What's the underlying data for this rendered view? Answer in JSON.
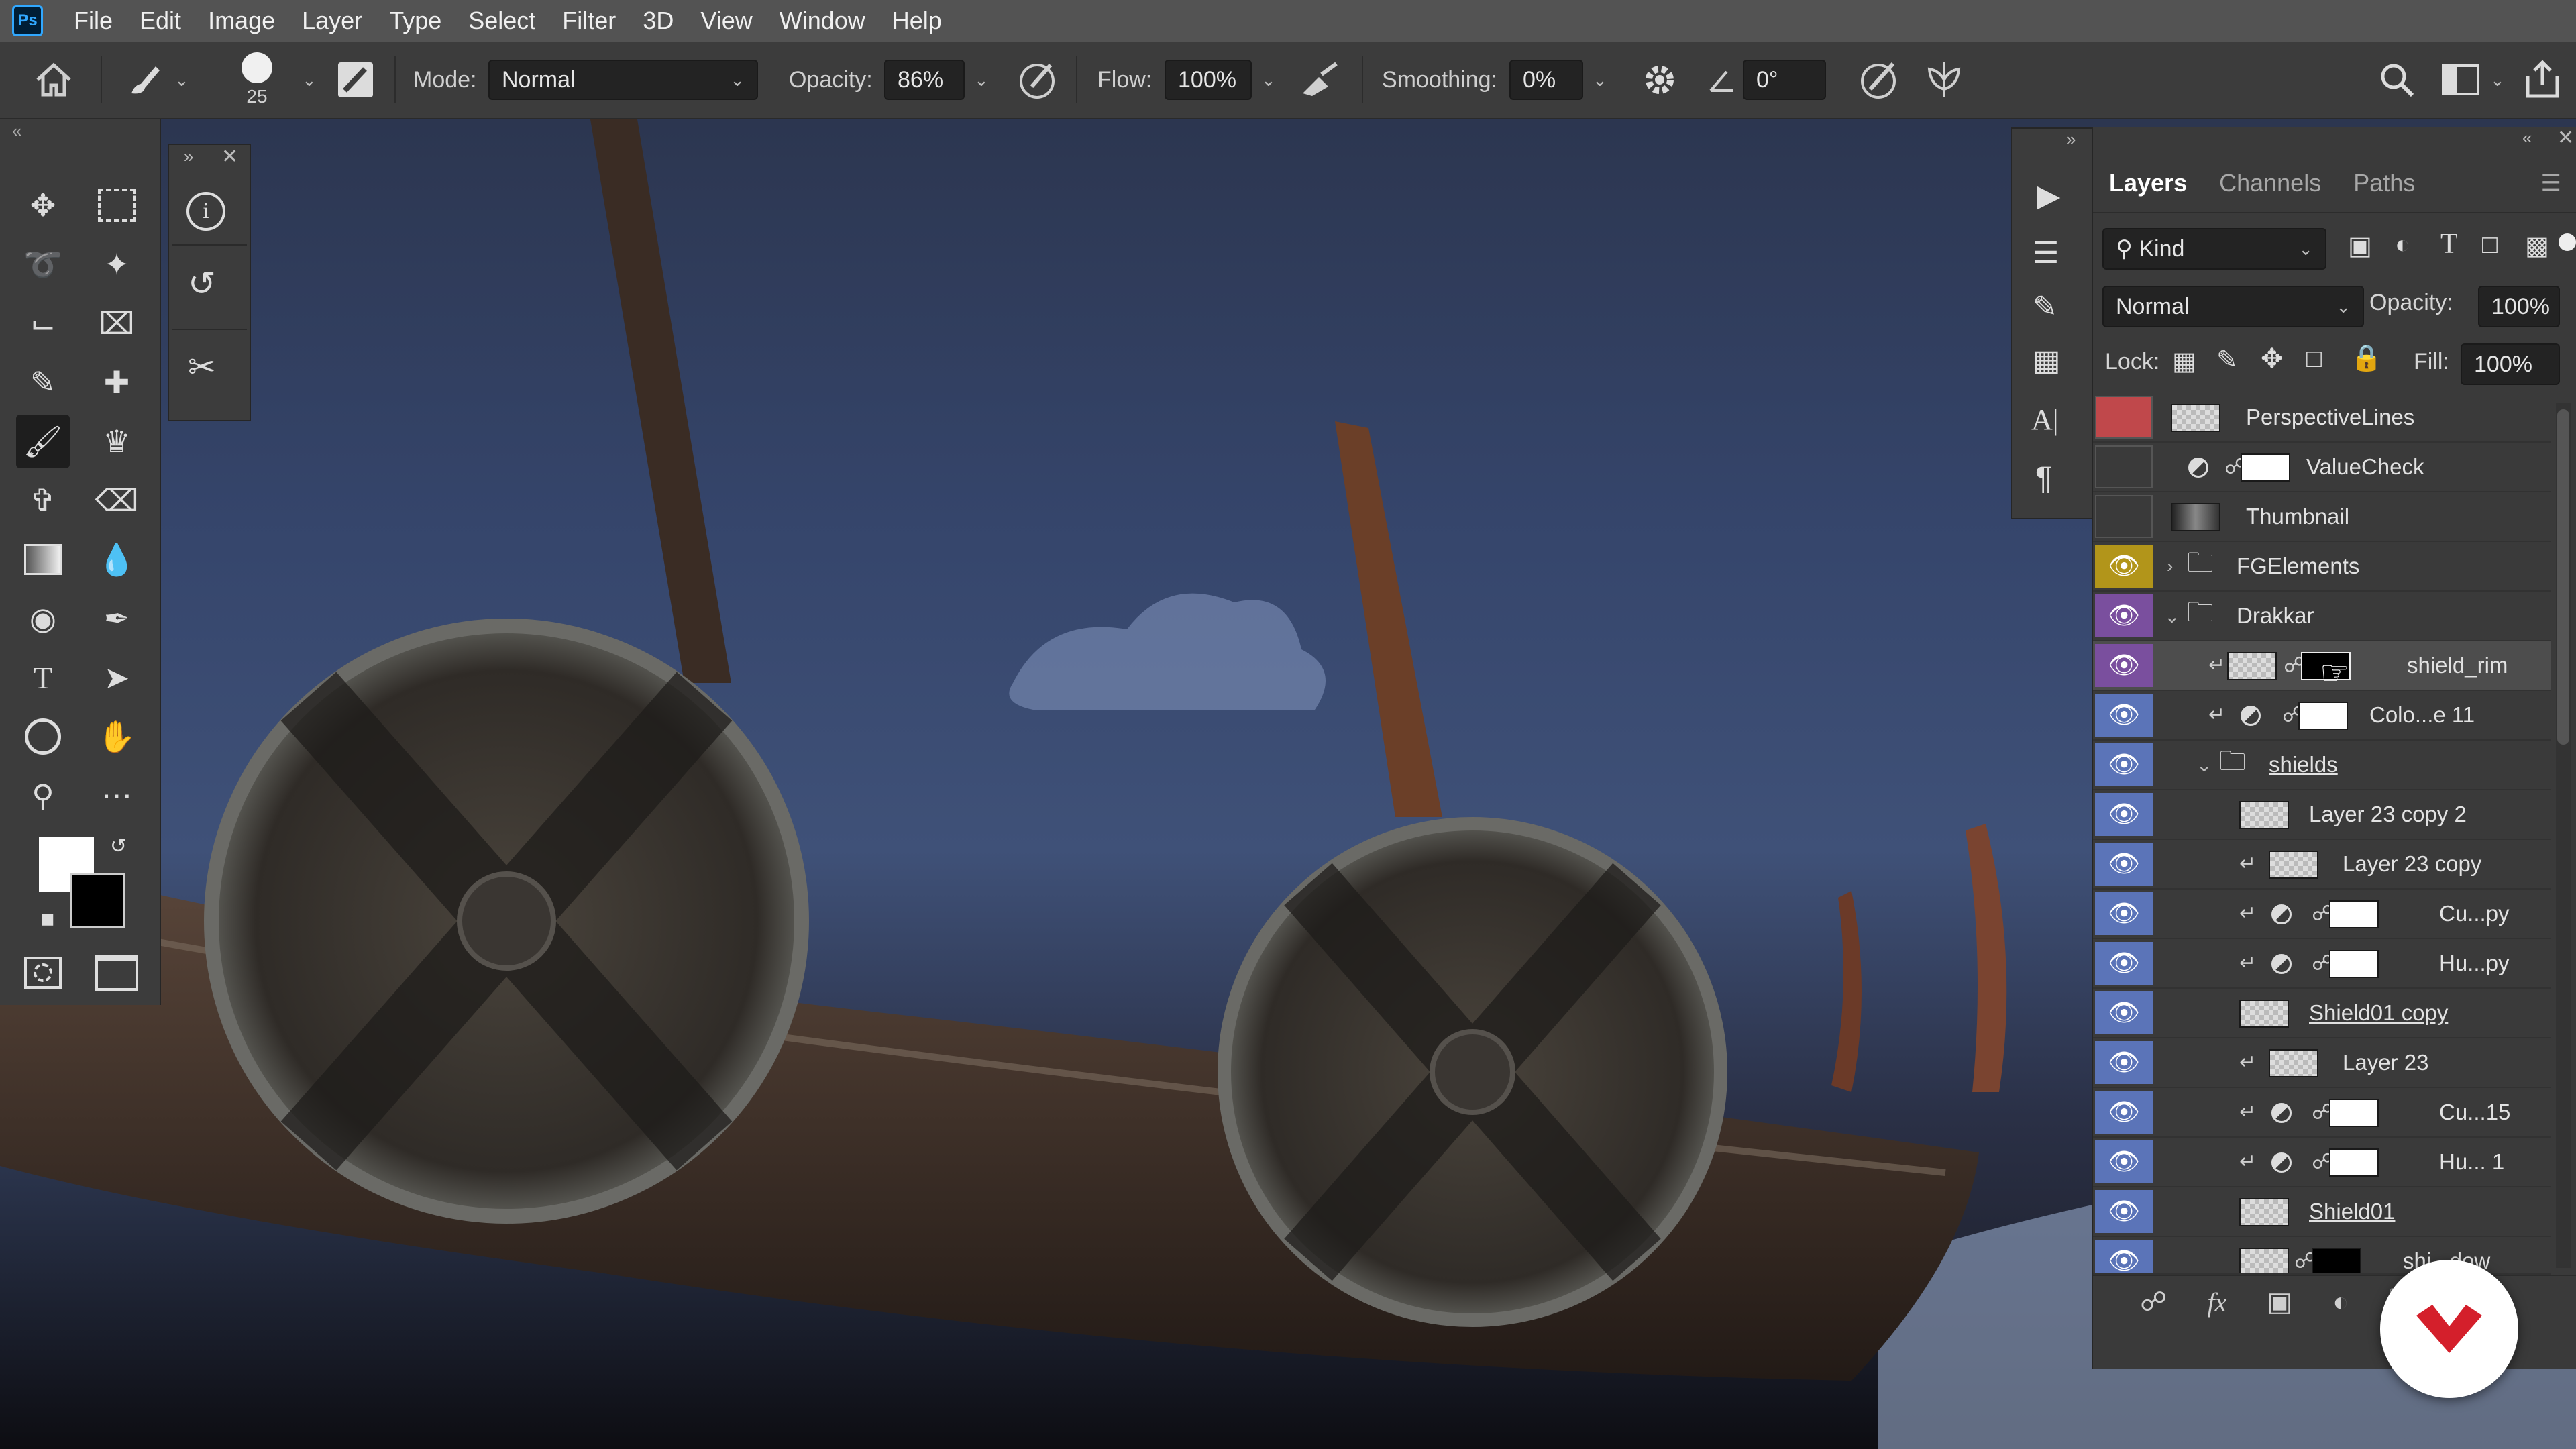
{
  "app": {
    "logo_text": "Ps"
  },
  "menu": [
    "File",
    "Edit",
    "Image",
    "Layer",
    "Type",
    "Select",
    "Filter",
    "3D",
    "View",
    "Window",
    "Help"
  ],
  "options_bar": {
    "brush_size": "25",
    "mode_label": "Mode:",
    "mode_value": "Normal",
    "opacity_label": "Opacity:",
    "opacity_value": "86%",
    "flow_label": "Flow:",
    "flow_value": "100%",
    "smoothing_label": "Smoothing:",
    "smoothing_value": "0%",
    "angle_value": "0°"
  },
  "layers_panel": {
    "tabs": [
      "Layers",
      "Channels",
      "Paths"
    ],
    "active_tab": "Layers",
    "filter_label": "Kind",
    "blend_mode": "Normal",
    "opacity_label": "Opacity:",
    "opacity_value": "100%",
    "lock_label": "Lock:",
    "fill_label": "Fill:",
    "fill_value": "100%",
    "layers": [
      {
        "name": "PerspectiveLines",
        "color_tag": "#c0484b",
        "visible": false
      },
      {
        "name": "ValueCheck",
        "color_tag": "",
        "visible": false
      },
      {
        "name": "Thumbnail",
        "color_tag": "",
        "visible": false
      },
      {
        "name": "FGElements",
        "color_tag": "#b2951a",
        "visible": true
      },
      {
        "name": "Drakkar",
        "color_tag": "#7a4f9e",
        "visible": true
      },
      {
        "name": "shield_rim",
        "color_tag": "#7a4f9e",
        "visible": true
      },
      {
        "name": "Colo...e 11",
        "color_tag": "#5b74b8",
        "visible": true
      },
      {
        "name": "shields",
        "color_tag": "#5b74b8",
        "visible": true
      },
      {
        "name": "Layer 23 copy 2",
        "color_tag": "#5b74b8",
        "visible": true
      },
      {
        "name": "Layer 23 copy",
        "color_tag": "#5b74b8",
        "visible": true
      },
      {
        "name": "Cu...py",
        "color_tag": "#5b74b8",
        "visible": true
      },
      {
        "name": "Hu...py",
        "color_tag": "#5b74b8",
        "visible": true
      },
      {
        "name": "Shield01 copy",
        "color_tag": "#5b74b8",
        "visible": true
      },
      {
        "name": "Layer 23",
        "color_tag": "#5b74b8",
        "visible": true
      },
      {
        "name": "Cu...15",
        "color_tag": "#5b74b8",
        "visible": true
      },
      {
        "name": "Hu... 1",
        "color_tag": "#5b74b8",
        "visible": true
      },
      {
        "name": "Shield01",
        "color_tag": "#5b74b8",
        "visible": true
      },
      {
        "name": "shi...dow",
        "color_tag": "#5b74b8",
        "visible": true
      }
    ],
    "footer_fx": "fx"
  },
  "colors": {
    "foreground": "#ffffff",
    "background": "#000000",
    "accent": "#31a8ff"
  }
}
